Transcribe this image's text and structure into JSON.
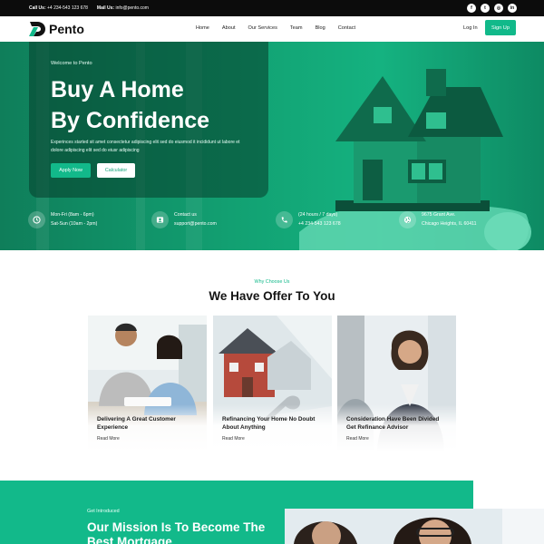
{
  "topbar": {
    "call_label": "Call Us:",
    "call_value": "+4 234-543 123 678",
    "mail_label": "Mail Us:",
    "mail_value": "info@pento.com",
    "social": [
      "f",
      "t",
      "◎",
      "in"
    ]
  },
  "header": {
    "brand": "Pento",
    "nav": [
      "Home",
      "About",
      "Our Services",
      "Team",
      "Blog",
      "Contact"
    ],
    "login": "Log In",
    "signup": "Sign Up"
  },
  "hero": {
    "welcome": "Welcome to Pento",
    "title_line1": "Buy A Home",
    "title_line2": "By Confidence",
    "description": "Experinces started sit amet consectetur adipiscing elit sed do eiusmod it incididunt ut labore et dolore adipiscing elit sed do eiusr adipiscing",
    "apply_button": "Apply Now",
    "calculator_button": "Calculator",
    "info": [
      {
        "icon": "clock-icon",
        "line1": "Mon-Fri (8am - 6pm)",
        "line2": "Sat-Sun (10am - 2pm)"
      },
      {
        "icon": "contact-card-icon",
        "line1": "Contact us",
        "line2": "support@pento.com"
      },
      {
        "icon": "phone-icon",
        "line1": "(24 hours / 7 days)",
        "line2": "+4 234-543 123 678"
      },
      {
        "icon": "globe-icon",
        "line1": "9675 Grant Ave.",
        "line2": "Chicago Heights, IL 60411"
      }
    ]
  },
  "offer": {
    "tag": "Why Choose Us",
    "title": "We Have Offer To You",
    "cards": [
      {
        "title": "Delivering A Great Customer Experience",
        "link": "Read More"
      },
      {
        "title": "Refinancing Your Home No Doubt About Anything",
        "link": "Read More"
      },
      {
        "title": "Consideration Have Been Divided Get Refinance Advisor",
        "link": "Read More"
      }
    ]
  },
  "mission": {
    "tag": "Get Introduced",
    "title": "Our Mission Is To Become The Best Mortgage"
  },
  "colors": {
    "accent": "#11b98a",
    "hero_dark": "#0f7e5a",
    "topbar": "#0c0c0c"
  }
}
